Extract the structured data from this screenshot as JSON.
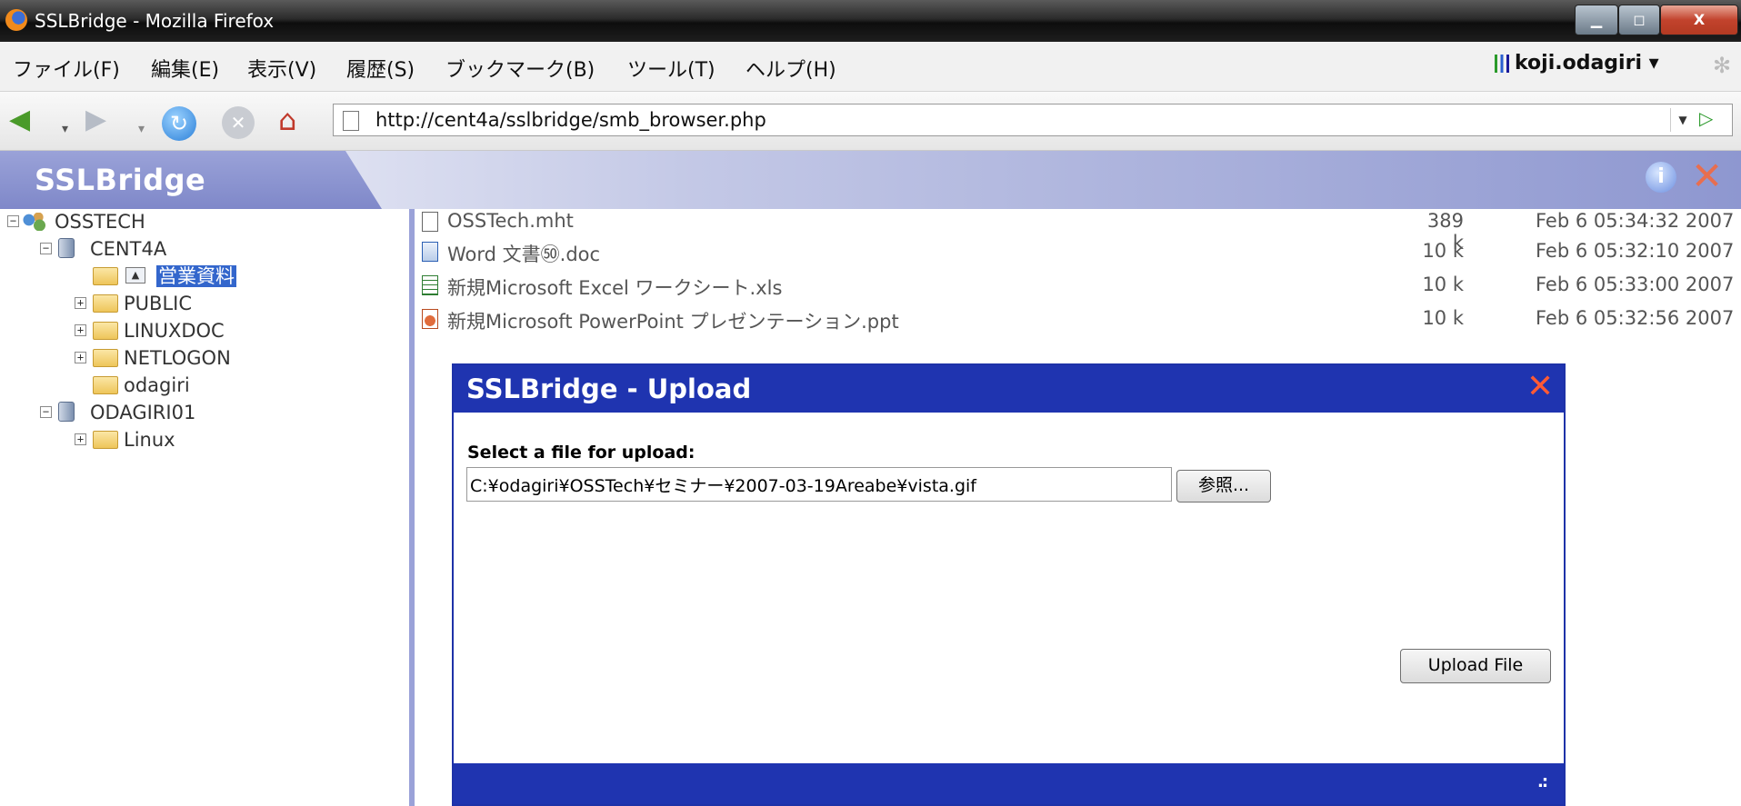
{
  "window": {
    "title": "SSLBridge - Mozilla Firefox",
    "min_icon": "▁",
    "max_icon": "◻",
    "close_icon": "X"
  },
  "menu": {
    "items": [
      "ファイル(F)",
      "編集(E)",
      "表示(V)",
      "履歴(S)",
      "ブックマーク(B)",
      "ツール(T)",
      "ヘルプ(H)"
    ],
    "user": "koji.odagiri ▾"
  },
  "nav": {
    "url": "http://cent4a/sslbridge/smb_browser.php"
  },
  "app": {
    "brand": "SSLBridge",
    "info_icon": "i",
    "close_icon": "✕"
  },
  "tree": [
    {
      "label": "OSSTECH",
      "toggle": "−",
      "icon": "network-icon"
    },
    {
      "label": "CENT4A",
      "toggle": "−",
      "icon": "server-icon"
    },
    {
      "label": "営業資料",
      "toggle": "",
      "icon": "folder-icon",
      "selected": true
    },
    {
      "label": "PUBLIC",
      "toggle": "+",
      "icon": "folder-icon"
    },
    {
      "label": "LINUXDOC",
      "toggle": "+",
      "icon": "folder-icon"
    },
    {
      "label": "NETLOGON",
      "toggle": "+",
      "icon": "folder-icon"
    },
    {
      "label": "odagiri",
      "toggle": "",
      "icon": "folder-icon"
    },
    {
      "label": "ODAGIRI01",
      "toggle": "−",
      "icon": "server-icon"
    },
    {
      "label": "Linux",
      "toggle": "+",
      "icon": "folder-icon"
    }
  ],
  "files": [
    {
      "name": "OSSTech.mht",
      "size": "389 k",
      "date": "Feb 6 05:34:32 2007",
      "icon": "file-icon"
    },
    {
      "name": "Word 文書㊿.doc",
      "size": "10 k",
      "date": "Feb 6 05:32:10 2007",
      "icon": "word-doc-icon"
    },
    {
      "name": "新規Microsoft Excel ワークシート.xls",
      "size": "10 k",
      "date": "Feb 6 05:33:00 2007",
      "icon": "excel-sheet-icon"
    },
    {
      "name": "新規Microsoft PowerPoint プレゼンテーション.ppt",
      "size": "10 k",
      "date": "Feb 6 05:32:56 2007",
      "icon": "powerpoint-icon"
    }
  ],
  "dialog": {
    "title": "SSLBridge - Upload",
    "close_icon": "✕",
    "prompt": "Select a file for upload:",
    "file_value": "C:¥odagiri¥OSSTech¥セミナー¥2007-03-19Areabe¥vista.gif",
    "browse_label": "参照...",
    "upload_label": "Upload File",
    "resize_icon": ".:"
  }
}
